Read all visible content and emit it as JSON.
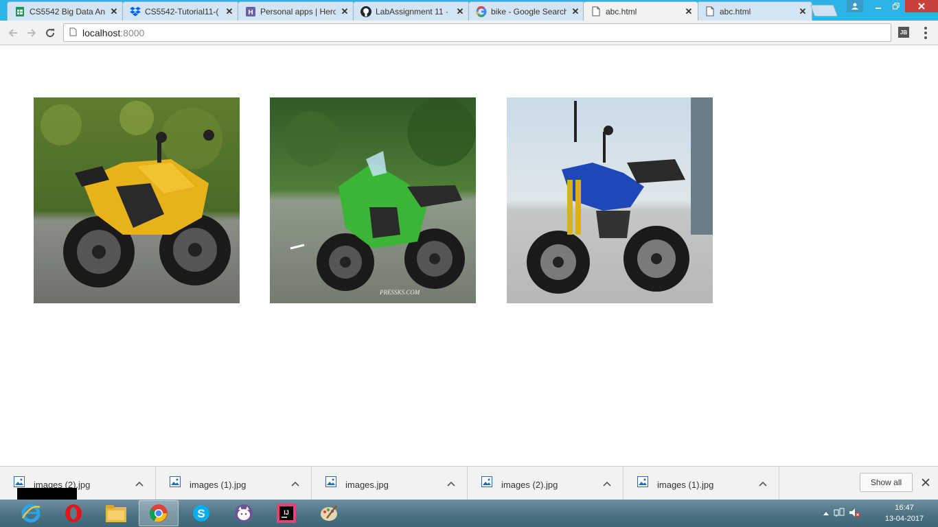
{
  "browser": {
    "tabs": [
      {
        "title": "CS5542 Big Data An",
        "icon": "google-sheets-icon",
        "color": "#0f9d58",
        "active": false
      },
      {
        "title": "CS5542-Tutorial11-(",
        "icon": "dropbox-icon",
        "color": "#0061fe",
        "active": false
      },
      {
        "title": "Personal apps | Hero",
        "icon": "heroku-icon",
        "color": "#6762a6",
        "active": false
      },
      {
        "title": "LabAssignment 11 ·",
        "icon": "github-icon",
        "color": "#24292e",
        "active": false
      },
      {
        "title": "bike - Google Search",
        "icon": "google-icon",
        "color": "#4285f4",
        "active": false
      },
      {
        "title": "abc.html",
        "icon": "page-icon",
        "color": "#555555",
        "active": true
      },
      {
        "title": "abc.html",
        "icon": "page-icon",
        "color": "#555555",
        "active": false
      }
    ],
    "address": {
      "host": "localhost",
      "port": ":8000"
    },
    "extension_label": "JB"
  },
  "page": {
    "images": [
      {
        "alt": "yellow sport motorcycle",
        "color": "#e7b21a"
      },
      {
        "alt": "green sport motorcycle",
        "color": "#3cb536"
      },
      {
        "alt": "blue street motorcycle",
        "color": "#1f47b8"
      }
    ]
  },
  "downloads": {
    "items": [
      {
        "name": "images (2).jpg"
      },
      {
        "name": "images (1).jpg"
      },
      {
        "name": "images.jpg"
      },
      {
        "name": "images (2).jpg"
      },
      {
        "name": "images (1).jpg"
      }
    ],
    "show_all_label": "Show all"
  },
  "taskbar": {
    "apps": [
      "internet-explorer-icon",
      "opera-icon",
      "file-explorer-icon",
      "chrome-icon",
      "skype-icon",
      "github-desktop-icon",
      "intellij-icon",
      "paint-icon"
    ],
    "clock": {
      "time": "16:47",
      "date": "13-04-2017"
    }
  }
}
